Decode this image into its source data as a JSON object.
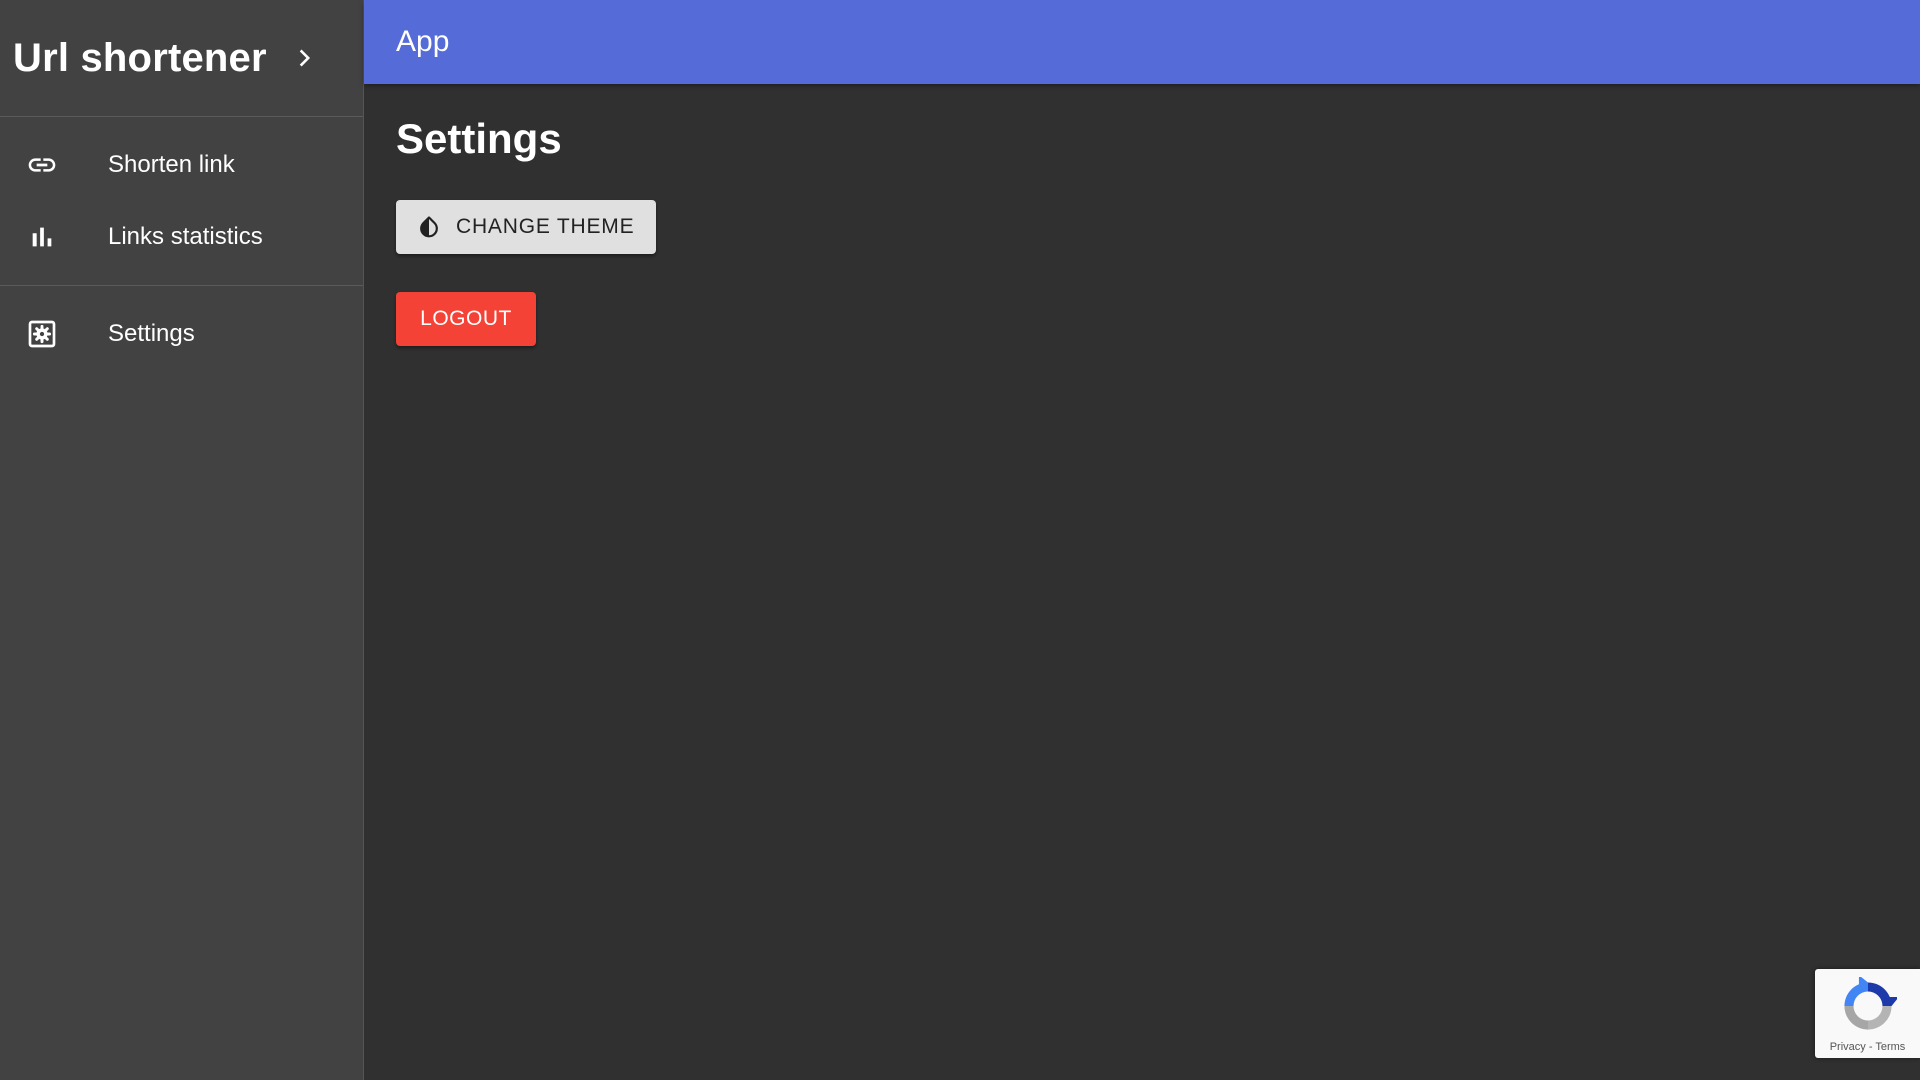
{
  "sidebar": {
    "brand": "Url shortener",
    "expand_icon": "chevron-right-icon",
    "items": [
      {
        "label": "Shorten link",
        "icon": "link-icon"
      },
      {
        "label": "Links statistics",
        "icon": "bar-chart-icon"
      },
      {
        "label": "Settings",
        "icon": "settings-box-icon"
      }
    ]
  },
  "appbar": {
    "title": "App",
    "color": "#546bd8"
  },
  "main": {
    "title": "Settings",
    "change_theme_label": "CHANGE THEME",
    "change_theme_icon": "invert-colors-icon",
    "logout_label": "LOGOUT",
    "logout_color": "#f44336"
  },
  "recaptcha": {
    "privacy": "Privacy",
    "separator": " - ",
    "terms": "Terms"
  }
}
